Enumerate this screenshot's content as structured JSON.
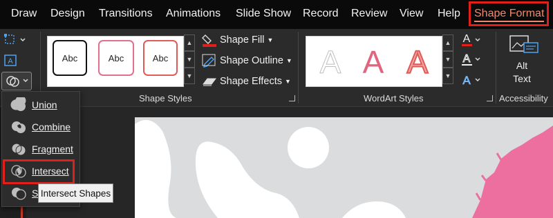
{
  "tabs": [
    {
      "label": "Draw",
      "active": false
    },
    {
      "label": "Design",
      "active": false
    },
    {
      "label": "Transitions",
      "active": false
    },
    {
      "label": "Animations",
      "active": false
    },
    {
      "label": "Slide Show",
      "active": false
    },
    {
      "label": "Record",
      "active": false
    },
    {
      "label": "Review",
      "active": false
    },
    {
      "label": "View",
      "active": false
    },
    {
      "label": "Help",
      "active": false
    },
    {
      "label": "Shape Format",
      "active": true
    }
  ],
  "colors": {
    "accent": "#f08a6e",
    "highlight_box": "#e0201a",
    "ribbon_bg": "#2b2b2b",
    "tabbar_bg": "#0a0a0a",
    "shape_fill_bar": "#e0201a",
    "wordart_pink": "#e0667f",
    "slide_bg": "#dadcdd",
    "slide_shape_pink": "#ec6fa0"
  },
  "shape_styles": {
    "group_label": "Shape Styles",
    "thumbnails": [
      {
        "label": "Abc"
      },
      {
        "label": "Abc"
      },
      {
        "label": "Abc"
      }
    ],
    "commands": {
      "fill": "Shape Fill",
      "outline": "Shape Outline",
      "effects": "Shape Effects"
    }
  },
  "wordart_styles": {
    "group_label": "WordArt Styles",
    "thumbnails": [
      {
        "label": "A"
      },
      {
        "label": "A"
      },
      {
        "label": "A"
      }
    ]
  },
  "accessibility": {
    "group_label": "Accessibility",
    "alt_text_line1": "Alt",
    "alt_text_line2": "Text"
  },
  "merge_menu": {
    "items": [
      {
        "label": "Union",
        "icon": "union-icon"
      },
      {
        "label": "Combine",
        "icon": "combine-icon"
      },
      {
        "label": "Fragment",
        "icon": "fragment-icon"
      },
      {
        "label": "Intersect",
        "icon": "intersect-icon"
      },
      {
        "label": "Subtract",
        "icon": "subtract-icon"
      }
    ],
    "tooltip": "Intersect Shapes"
  }
}
